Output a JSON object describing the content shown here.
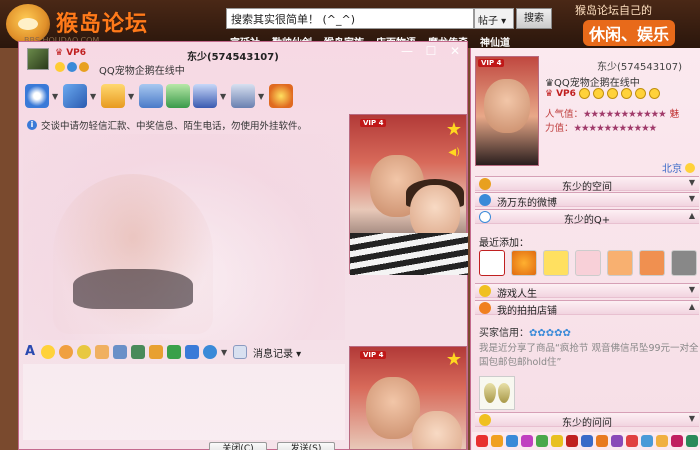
{
  "forum": {
    "logo_name": "猴岛论坛",
    "logo_url": "BBS.HOUDAO.COM",
    "search_value": "搜索其实很简单！ (^_^)",
    "search_type": "帖子",
    "search_button": "搜索",
    "nav": [
      "宣延社",
      "勤帅仙剑",
      "猴岛家族",
      "店面物语",
      "魔龙传奇",
      "神仙道"
    ],
    "slogan_line1": "猴岛论坛自己的",
    "slogan_line2": "休闲、娱乐"
  },
  "chat": {
    "vip": "VP6",
    "title": "东少(574543107)",
    "status": "QQ宠物企鹅在线中",
    "window_buttons": [
      "—",
      "☐",
      "✕"
    ],
    "notice": "交谈中请勿轻信汇款、中奖信息、陌生电话，勿使用外挂软件。",
    "message_record": "消息记录",
    "close_button": "关闭(C)",
    "send_button": "发送(S)",
    "vip_tag": "VIP 4",
    "colors": {
      "accent": "#c46a8e",
      "window_bg": "#f7d9e4"
    }
  },
  "panel": {
    "name": "东少(574543107)",
    "status": "QQ宠物企鹅在线中",
    "vip": "VP6",
    "vip_tag": "VIP 4",
    "popularity_label": "人气值：",
    "popularity_stars": "★★★★★★★★★★★",
    "popularity_suffix": "魅",
    "strength_label": "力值：",
    "strength_stars": "★★★★★★★★★★★",
    "location": "北京",
    "sections": {
      "space": "东少的空间",
      "weibo": "汤万东的微博",
      "qplus": "东少的Q+",
      "games": "游戏人生",
      "shop": "我的拍拍店铺",
      "wenwen": "东少的问问"
    },
    "recent_label": "最近添加：",
    "buyer_label": "买家信用：",
    "buyer_stars": "✿✿✿✿✿",
    "buyer_desc": "我是近分享了商品“疯抢节 观音佛信吊坠99元一对全国包邮包邮hold住”"
  }
}
